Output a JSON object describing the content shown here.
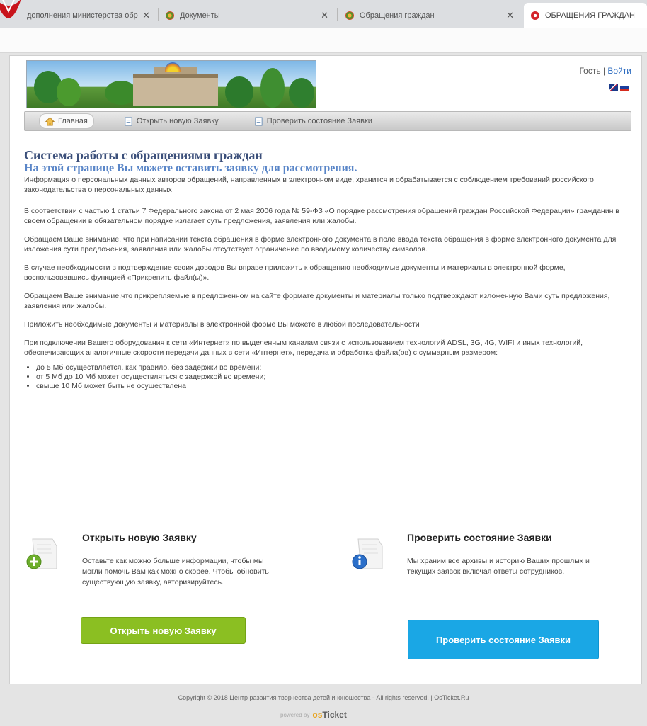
{
  "browser": {
    "tabs": [
      {
        "title": "дополнения министерства обр",
        "active": false
      },
      {
        "title": "Документы",
        "active": false
      },
      {
        "title": "Обращения граждан",
        "active": false
      },
      {
        "title": "ОБРАЩЕНИЯ ГРАЖДАН",
        "active": true
      }
    ],
    "close_glyph": "✕"
  },
  "header": {
    "guest_label": "Гость",
    "separator": "|",
    "login_link": "Войти"
  },
  "nav": {
    "home": "Главная",
    "open_ticket": "Открыть новую Заявку",
    "check_status": "Проверить состояние Заявки"
  },
  "content": {
    "title": "Система работы с обращениями граждан",
    "subtitle": "На этой странице Вы можете оставить заявку для рассмотрения.",
    "paragraphs": [
      "Информация о персональных данных авторов обращений, направленных в электронном виде, хранится и обрабатывается с соблюдением требований российского законодательства о персональных данных",
      "В соответствии с частью 1 статьи 7 Федерального закона от 2 мая 2006 года № 59-ФЗ «О порядке рассмотрения обращений граждан Российской Федерации» гражданин в своем обращении в обязательном порядке излагает суть предложения, заявления или жалобы.",
      "Обращаем Ваше внимание, что при написании текста обращения в форме электронного документа в поле ввода текста обращения в форме электронного документа для изложения сути предложения, заявления или жалобы отсутствует ограничение по вводимому количеству символов.",
      "В случае необходимости в подтверждение своих доводов Вы вправе приложить к обращению необходимые документы и материалы в электронной форме, воспользовавшись функцией «Прикрепить файл(ы)».",
      "Обращаем Ваше внимание,что прикрепляемые в предложенном на сайте формате документы и материалы только подтверждают изложенную Вами суть предложения, заявления или жалобы.",
      "Приложить необходимые документы и материалы в электронной форме Вы можете в любой последовательности",
      "При подключении Вашего оборудования к сети «Интернет» по выделенным каналам связи с использованием технологий ADSL, 3G, 4G, WIFI и иных технологий, обеспечивающих аналогичные скорости передачи данных в сети «Интернет», передача и обработка файла(ов) с суммарным размером:"
    ],
    "limits": [
      "до 5 Мб осуществляется, как правило, без задержки во времени;",
      "от 5 Мб до 10 Мб может осуществляться с задержкой во времени;",
      "свыше 10 Мб может быть не осуществлена"
    ]
  },
  "actions": {
    "open": {
      "title": "Открыть новую Заявку",
      "description": "Оставьте как можно больше информации, чтобы мы могли помочь Вам как можно скорее. Чтобы обновить существующую заявку, авторизируйтесь.",
      "button": "Открыть новую Заявку"
    },
    "check": {
      "title": "Проверить состояние Заявки",
      "description": "Мы храним все архивы и историю Ваших прошлых и текущих заявок включая ответы сотрудников.",
      "button": "Проверить состояние Заявки"
    }
  },
  "footer": {
    "copyright": "Copyright © 2018 Центр развития творчества детей и юношества - All rights reserved. | OsTicket.Ru",
    "powered_by": "powered by",
    "brand_os": "os",
    "brand_ticket": "Ticket"
  },
  "colors": {
    "green_button": "#8bbf22",
    "blue_button": "#1aa7e5",
    "title": "#3b4f7a",
    "subtitle": "#5a86c8",
    "link": "#2d6cc0"
  }
}
